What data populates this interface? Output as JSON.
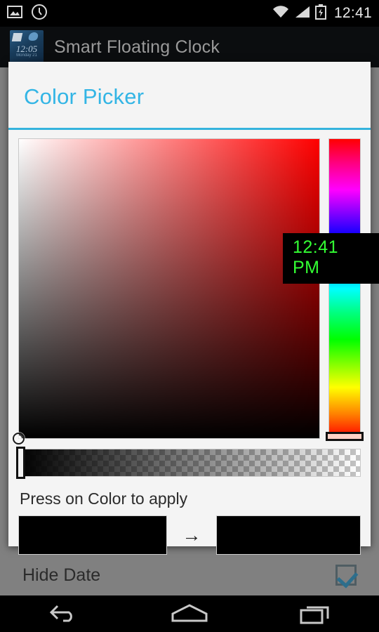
{
  "statusbar": {
    "clock": "12:41",
    "icons": [
      "image-icon",
      "clock-icon",
      "wifi-icon",
      "signal-icon",
      "battery-charging-icon"
    ]
  },
  "actionbar": {
    "app_icon_time": "12:05",
    "app_icon_sub": "Monday 21",
    "title": "Smart Floating Clock"
  },
  "dialog": {
    "title": "Color Picker",
    "apply_hint": "Press on Color to apply",
    "arrow": "→",
    "accent_color": "#33b5e5",
    "divider_color": "#35b3dd",
    "old_color": "#000000",
    "new_color": "#000000",
    "selected_hue": "#ff0000",
    "sv_cursor_position": "bottom-left",
    "hue_cursor_position": "bottom",
    "alpha_cursor_position": "left"
  },
  "floating_clock": {
    "time": "12:41 PM",
    "text_color": "#33ff33",
    "background_color": "#000000"
  },
  "background_setting": {
    "label": "Hide Date",
    "checked": true,
    "check_color": "#2d6e8c"
  },
  "navbar": {
    "buttons": [
      "back-button",
      "home-button",
      "recents-button"
    ]
  }
}
